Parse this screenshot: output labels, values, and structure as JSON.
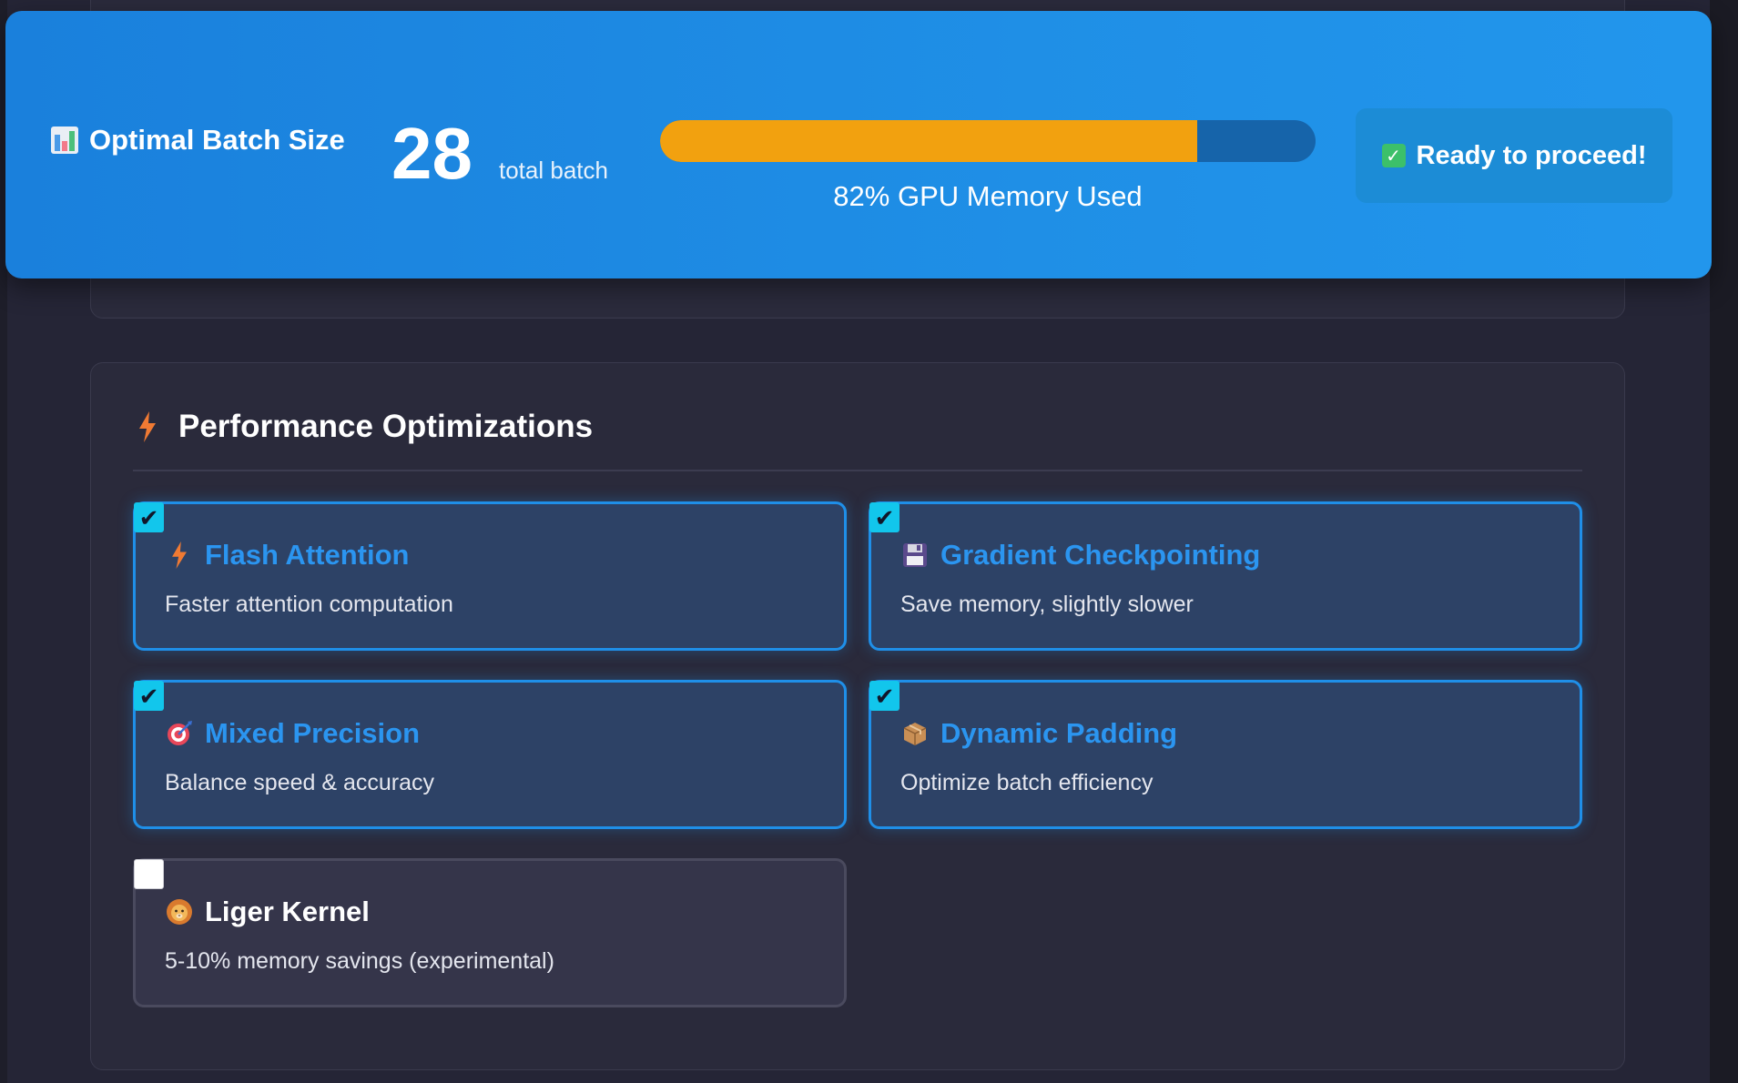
{
  "banner": {
    "title": "Optimal Batch Size",
    "title_icon": "bar-chart-icon",
    "batch_value": "28",
    "batch_unit": "total batch",
    "memory_fraction": 0.82,
    "memory_label": "82% GPU Memory Used",
    "ready_label": "Ready to proceed!",
    "ready_icon": "check-mark-button-icon"
  },
  "performance": {
    "title": "Performance Optimizations",
    "title_icon": "lightning-icon",
    "options": [
      {
        "title": "Flash Attention",
        "desc": "Faster attention computation",
        "icon": "lightning-icon",
        "checked": true
      },
      {
        "title": "Gradient Checkpointing",
        "desc": "Save memory, slightly slower",
        "icon": "floppy-disk-icon",
        "checked": true
      },
      {
        "title": "Mixed Precision",
        "desc": "Balance speed & accuracy",
        "icon": "target-icon",
        "checked": true
      },
      {
        "title": "Dynamic Padding",
        "desc": "Optimize batch efficiency",
        "icon": "package-icon",
        "checked": true
      },
      {
        "title": "Liger Kernel",
        "desc": "5-10% memory savings (experimental)",
        "icon": "lion-icon",
        "checked": false
      }
    ]
  },
  "colors": {
    "banner_blue": "#1f8fe6",
    "memory_fill": "#f2a10f",
    "accent_blue": "#2b95f0",
    "checkbox_cyan": "#12c6ec"
  }
}
